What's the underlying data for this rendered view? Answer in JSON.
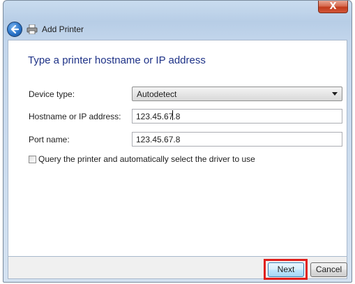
{
  "window": {
    "close_symbol": "X",
    "title": "Add Printer",
    "back_icon": "back-arrow-icon",
    "printer_icon": "printer-icon"
  },
  "page": {
    "heading": "Type a printer hostname or IP address"
  },
  "form": {
    "device_type_label": "Device type:",
    "device_type_value": "Autodetect",
    "hostname_label": "Hostname or IP address:",
    "hostname_value": "123.45.67.8",
    "port_label": "Port name:",
    "port_value": "123.45.67.8",
    "query_checkbox_label": "Query the printer and automatically select the driver to use",
    "query_checked": false
  },
  "footer": {
    "next_label": "Next",
    "cancel_label": "Cancel"
  },
  "colors": {
    "heading": "#1e3287",
    "highlight": "#e0201c",
    "close_button": "#c13b1c"
  }
}
